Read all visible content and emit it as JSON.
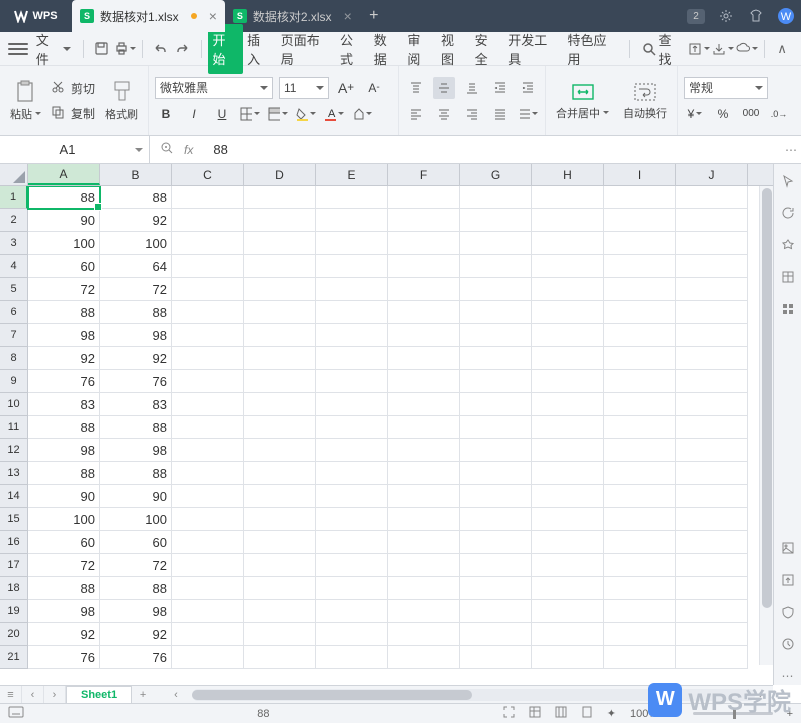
{
  "title": {
    "wps": "WPS"
  },
  "tabs_top": [
    {
      "label": "数据核对1.xlsx",
      "active": true,
      "dot": true
    },
    {
      "label": "数据核对2.xlsx",
      "active": false,
      "dot": false
    }
  ],
  "title_badge": "2",
  "menu": {
    "file": "文件",
    "items": [
      "开始",
      "插入",
      "页面布局",
      "公式",
      "数据",
      "审阅",
      "视图",
      "安全",
      "开发工具",
      "特色应用"
    ],
    "search": "查找"
  },
  "toolbar": {
    "paste": "粘贴",
    "cut": "剪切",
    "copy": "复制",
    "format_painter": "格式刷",
    "font_name": "微软雅黑",
    "font_size": "11",
    "merge": "合并居中",
    "wrap": "自动换行",
    "num_format": "常规"
  },
  "namebox": "A1",
  "fx_value": "88",
  "columns": [
    "A",
    "B",
    "C",
    "D",
    "E",
    "F",
    "G",
    "H",
    "I",
    "J"
  ],
  "chart_data": {
    "type": "table",
    "columns": [
      "A",
      "B"
    ],
    "rows": [
      [
        88,
        88
      ],
      [
        90,
        92
      ],
      [
        100,
        100
      ],
      [
        60,
        64
      ],
      [
        72,
        72
      ],
      [
        88,
        88
      ],
      [
        98,
        98
      ],
      [
        92,
        92
      ],
      [
        76,
        76
      ],
      [
        83,
        83
      ],
      [
        88,
        88
      ],
      [
        98,
        98
      ],
      [
        88,
        88
      ],
      [
        90,
        90
      ],
      [
        100,
        100
      ],
      [
        60,
        60
      ],
      [
        72,
        72
      ],
      [
        88,
        88
      ],
      [
        98,
        98
      ],
      [
        92,
        92
      ],
      [
        76,
        76
      ]
    ]
  },
  "sheet": {
    "name": "Sheet1"
  },
  "status": {
    "val": "88",
    "zoom": "100%"
  },
  "watermark": "WPS学院",
  "newtab": "+"
}
